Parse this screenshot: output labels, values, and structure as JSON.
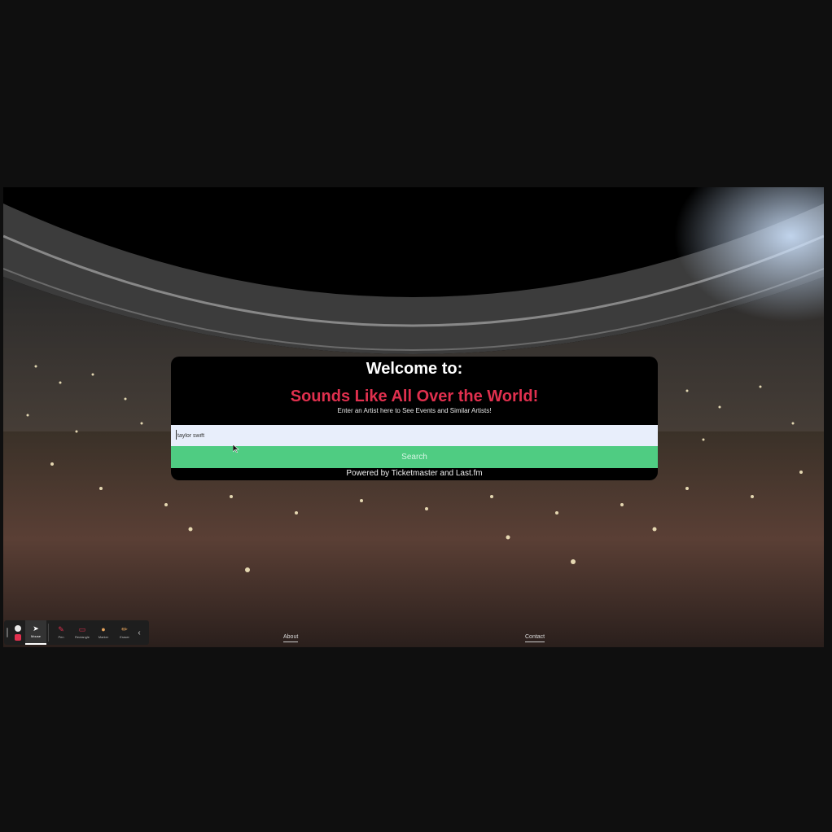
{
  "card": {
    "welcome": "Welcome to:",
    "title": "Sounds Like All Over the World!",
    "subtitle": "Enter an Artist here to See Events and Similar Artists!",
    "search_value": "taylor swift",
    "search_button": "Search",
    "powered_by": "Powered by Ticketmaster and Last.fm"
  },
  "nav": {
    "about": "About",
    "contact": "Contact"
  },
  "toolbar": {
    "items": [
      {
        "label": "Mouse",
        "icon": "pointer-icon"
      },
      {
        "label": "Pen",
        "icon": "pen-icon"
      },
      {
        "label": "Rectangle",
        "icon": "rectangle-icon"
      },
      {
        "label": "Marker",
        "icon": "marker-icon"
      },
      {
        "label": "Eraser",
        "icon": "eraser-icon"
      }
    ]
  },
  "colors": {
    "accent_title": "#e0304e",
    "search_button": "#4fcc82",
    "card_bg": "#000000"
  }
}
